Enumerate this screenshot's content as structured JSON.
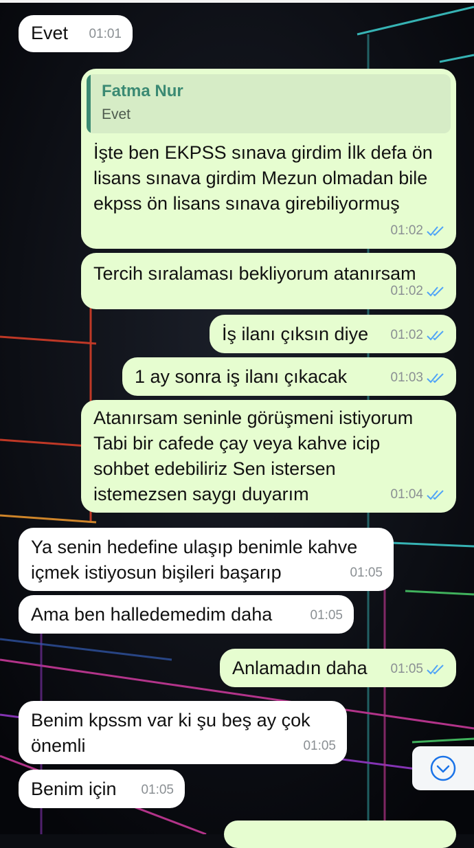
{
  "messages": [
    {
      "id": "m1",
      "dir": "in",
      "text": "Evet",
      "time": "01:01"
    },
    {
      "id": "m2",
      "dir": "out",
      "quote": {
        "name": "Fatma Nur",
        "text": "Evet"
      },
      "text": "İşte ben EKPSS sınava girdim İlk defa ön\nlisans sınava girdim Mezun olmadan bile\nekpss ön lisans sınava girebiliyormuş",
      "time": "01:02",
      "status": "read"
    },
    {
      "id": "m3",
      "dir": "out",
      "text": "Tercih sıralaması bekliyorum atanırsam",
      "time": "01:02",
      "status": "read"
    },
    {
      "id": "m4",
      "dir": "out",
      "text": "İş ilanı çıksın diye",
      "time": "01:02",
      "status": "read"
    },
    {
      "id": "m5",
      "dir": "out",
      "text": "1 ay sonra iş ilanı çıkacak",
      "time": "01:03",
      "status": "read"
    },
    {
      "id": "m6",
      "dir": "out",
      "text": "Atanırsam seninle görüşmeni istiyorum\nTabi bir cafede çay veya kahve icip\nsohbet edebiliriz Sen istersen\nistemezsen saygı duyarım",
      "time": "01:04",
      "status": "read"
    },
    {
      "id": "m7",
      "dir": "in",
      "text": "Ya senin hedefine ulaşıp benimle kahve\niçmek istiyosun bişileri başarıp",
      "time": "01:05"
    },
    {
      "id": "m8",
      "dir": "in",
      "text": "Ama ben halledemedim daha",
      "time": "01:05"
    },
    {
      "id": "m9",
      "dir": "out",
      "text": "Anlamadın daha",
      "time": "01:05",
      "status": "read"
    },
    {
      "id": "m10",
      "dir": "in",
      "text": "Benim kpssm var ki şu beş ay çok\nönemli",
      "time": "01:05"
    },
    {
      "id": "m11",
      "dir": "in",
      "text": "Benim için",
      "time": "01:05"
    },
    {
      "id": "m12",
      "dir": "out",
      "text": "",
      "time": "",
      "partial": true
    }
  ],
  "colors": {
    "incoming": "#ffffff",
    "outgoing": "#e6fdd0",
    "tick": "#4fa3f7",
    "quote_accent": "#3b8a73"
  },
  "icons": {
    "read_receipt": "double-check-icon",
    "scroll_down": "chevron-down-circle-icon"
  }
}
